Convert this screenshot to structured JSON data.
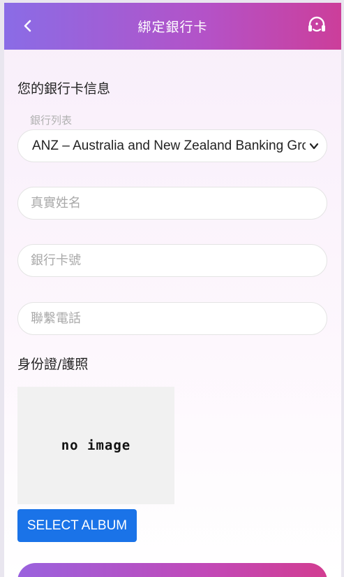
{
  "header": {
    "title": "綁定銀行卡",
    "back_icon": "chevron-left-icon",
    "support_icon": "headset-icon"
  },
  "bank_section": {
    "title": "您的銀行卡信息",
    "bank_list_label": "銀行列表",
    "selected_bank": "ANZ – Australia and New Zealand Banking Group",
    "real_name_placeholder": "真實姓名",
    "card_number_placeholder": "銀行卡號",
    "phone_placeholder": "聯繫電話"
  },
  "id_section": {
    "title": "身份證/護照",
    "image_placeholder": "no image",
    "select_album_label": "SELECT ALBUM"
  },
  "colors": {
    "header_gradient_start": "#8a6ce6",
    "header_gradient_end": "#cc3e9a",
    "album_button": "#1a73e8"
  }
}
